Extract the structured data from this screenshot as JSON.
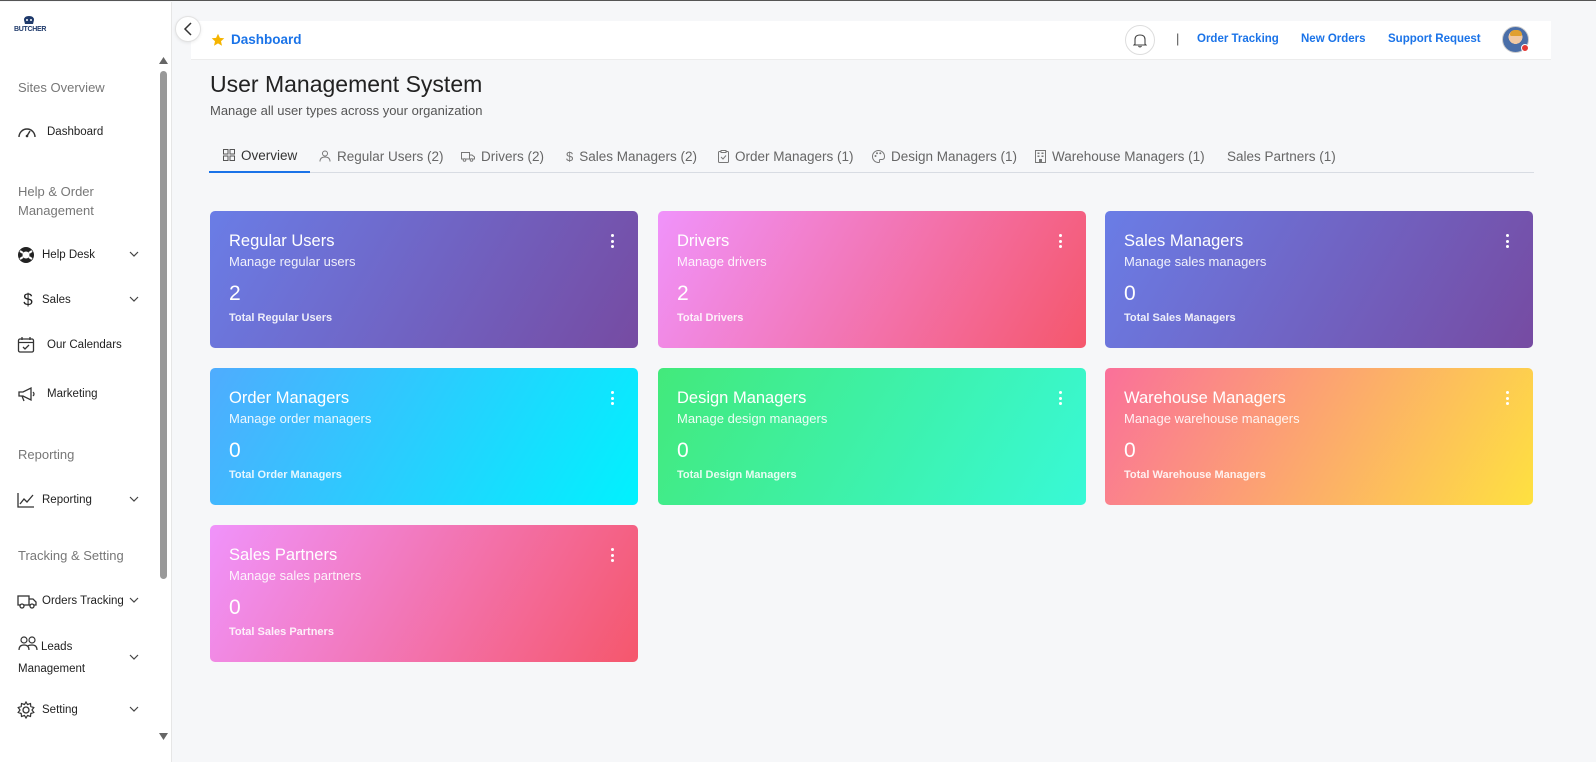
{
  "brand": {
    "logo_text": "BUTCHER"
  },
  "sidebar": {
    "sections": [
      {
        "label": "Sites Overview"
      },
      {
        "label": "Help & Order Management"
      },
      {
        "label": "Reporting"
      },
      {
        "label": "Tracking & Setting"
      }
    ],
    "items": [
      {
        "label": "Dashboard",
        "icon": "speedometer-icon"
      },
      {
        "label": "Help Desk",
        "icon": "lifebuoy-icon",
        "expandable": true
      },
      {
        "label": "Sales",
        "icon": "dollar-icon",
        "expandable": true
      },
      {
        "label": "Our Calendars",
        "icon": "calendar-check-icon"
      },
      {
        "label": "Marketing",
        "icon": "megaphone-icon"
      },
      {
        "label": "Reporting",
        "icon": "line-chart-icon",
        "expandable": true
      },
      {
        "label": "Orders Tracking",
        "icon": "truck-icon",
        "expandable": true
      },
      {
        "label": "Leads Management",
        "icon": "people-icon",
        "expandable": true
      },
      {
        "label": "Setting",
        "icon": "gear-icon",
        "expandable": true
      }
    ]
  },
  "topbar": {
    "breadcrumb": "Dashboard",
    "links": [
      "Order Tracking",
      "New Orders",
      "Support Request"
    ],
    "separator": "|"
  },
  "header": {
    "title": "User Management System",
    "subtitle": "Manage all user types across your organization"
  },
  "tabs": [
    {
      "label": "Overview",
      "icon": "grid-icon",
      "active": true
    },
    {
      "label": "Regular Users (2)",
      "icon": "user-icon"
    },
    {
      "label": "Drivers (2)",
      "icon": "truck-icon"
    },
    {
      "label": "Sales Managers (2)",
      "icon": "dollar-icon"
    },
    {
      "label": "Order Managers (1)",
      "icon": "clipboard-check-icon"
    },
    {
      "label": "Design Managers (1)",
      "icon": "palette-icon"
    },
    {
      "label": "Warehouse Managers (1)",
      "icon": "building-icon"
    },
    {
      "label": "Sales Partners (1)",
      "icon": ""
    }
  ],
  "cards": [
    {
      "title": "Regular Users",
      "subtitle": "Manage regular users",
      "count": "2",
      "count_label": "Total Regular Users",
      "colors": [
        "#6a7de6",
        "#764ba2"
      ]
    },
    {
      "title": "Drivers",
      "subtitle": "Manage drivers",
      "count": "2",
      "count_label": "Total Drivers",
      "colors": [
        "#f093fb",
        "#f5576c"
      ]
    },
    {
      "title": "Sales Managers",
      "subtitle": "Manage sales managers",
      "count": "0",
      "count_label": "Total Sales Managers",
      "colors": [
        "#6a7de6",
        "#764ba2"
      ]
    },
    {
      "title": "Order Managers",
      "subtitle": "Manage order managers",
      "count": "0",
      "count_label": "Total Order Managers",
      "colors": [
        "#4facfe",
        "#00f2fe"
      ]
    },
    {
      "title": "Design Managers",
      "subtitle": "Manage design managers",
      "count": "0",
      "count_label": "Total Design Managers",
      "colors": [
        "#43e97b",
        "#38f9d7"
      ]
    },
    {
      "title": "Warehouse Managers",
      "subtitle": "Manage warehouse managers",
      "count": "0",
      "count_label": "Total Warehouse Managers",
      "colors": [
        "#fa709a",
        "#fee140"
      ]
    },
    {
      "title": "Sales Partners",
      "subtitle": "Manage sales partners",
      "count": "0",
      "count_label": "Total Sales Partners",
      "colors": [
        "#f093fb",
        "#f5576c"
      ]
    }
  ],
  "theme": {
    "accent": "#1a73e8",
    "background": "#f6f7f9"
  }
}
